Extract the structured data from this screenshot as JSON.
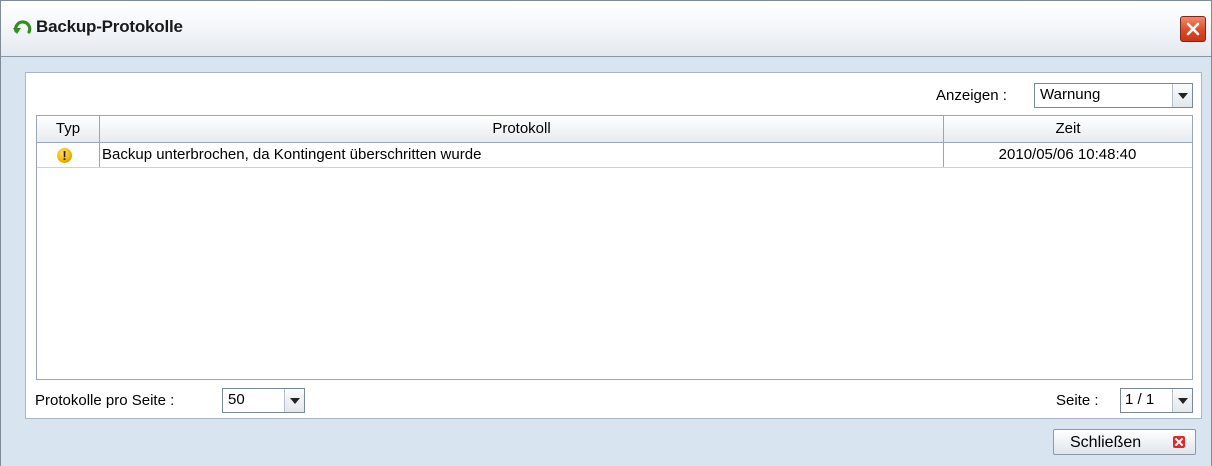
{
  "window": {
    "title": "Backup-Protokolle"
  },
  "filter": {
    "label": "Anzeigen :",
    "value": "Warnung"
  },
  "table": {
    "columns": [
      "Typ",
      "Protokoll",
      "Zeit"
    ],
    "rows": [
      {
        "type_icon": "warning-icon",
        "protocol": "Backup unterbrochen, da Kontingent überschritten wurde",
        "time": "2010/05/06 10:48:40"
      }
    ]
  },
  "pagination": {
    "per_page_label": "Protokolle pro Seite :",
    "per_page_value": "50",
    "page_label": "Seite :",
    "page_value": "1 / 1"
  },
  "buttons": {
    "close_label": "Schließen"
  },
  "colors": {
    "close_button_red": "#dd4a2a",
    "warning_yellow": "#f0b800",
    "panel_background": "#d8e4ef"
  }
}
